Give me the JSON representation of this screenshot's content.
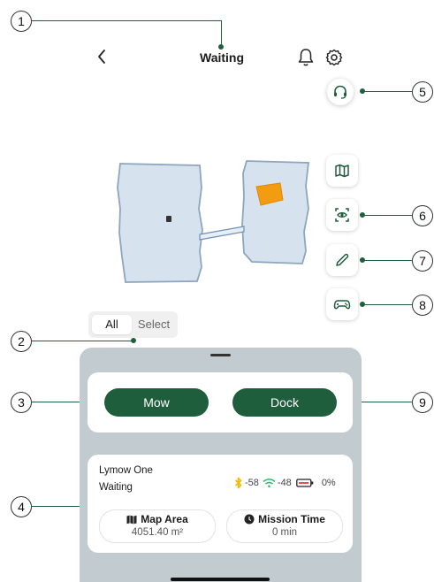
{
  "header": {
    "title": "Waiting"
  },
  "callouts": [
    "1",
    "2",
    "3",
    "4",
    "5",
    "6",
    "7",
    "8",
    "9"
  ],
  "tabs": [
    {
      "label": "All",
      "selected": true
    },
    {
      "label": "Select",
      "selected": false
    }
  ],
  "actions": {
    "mow_label": "Mow",
    "dock_label": "Dock"
  },
  "device": {
    "name": "Lymow One",
    "status": "Waiting",
    "bluetooth_signal": "-58",
    "wifi_signal": "-48",
    "battery_percent": "0%"
  },
  "stats": {
    "map_area_label": "Map Area",
    "map_area_value": "4051.40 m²",
    "mission_time_label": "Mission Time",
    "mission_time_value": "0 min"
  },
  "colors": {
    "accent": "#1f5e3d",
    "sheet": "#c2cbd0",
    "map_fill": "#d6e2ee",
    "map_stroke": "#8ea6bd",
    "zone": "#f39c12",
    "bluetooth": "#f5b800",
    "wifi": "#2dbd6e",
    "battery": "#d62828"
  }
}
